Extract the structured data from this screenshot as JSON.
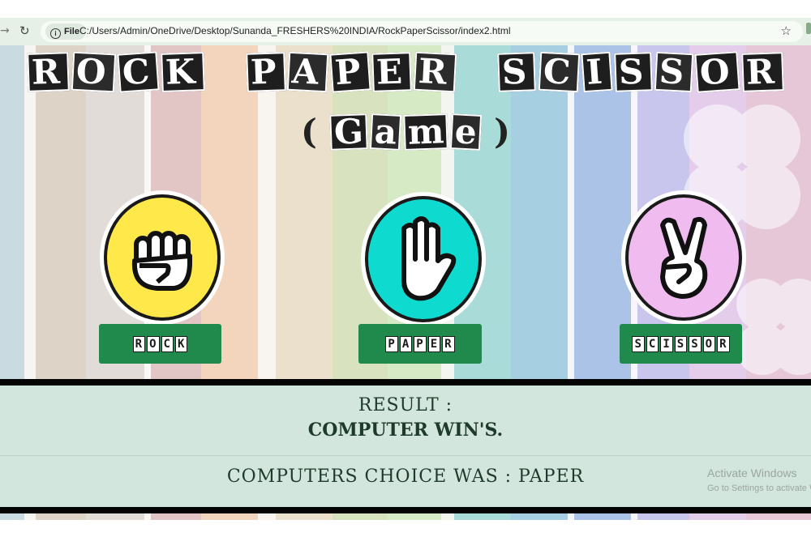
{
  "browser": {
    "file_label": "File",
    "url": "C:/Users/Admin/OneDrive/Desktop/Sunanda_FRESHERS%20INDIA/RockPaperScissor/index2.html"
  },
  "game": {
    "title_words": [
      "ROCK",
      "PAPER",
      "SCISSOR"
    ],
    "subtitle": "Game",
    "choices": [
      {
        "label": "ROCK",
        "circle_color": "#ffe94a",
        "icon": "fist-icon"
      },
      {
        "label": "PAPER",
        "circle_color": "#0fdad0",
        "icon": "open-hand-icon"
      },
      {
        "label": "SCISSOR",
        "circle_color": "#f0bcef",
        "icon": "victory-hand-icon"
      }
    ],
    "button_color": "#1f8a4c"
  },
  "result": {
    "heading": "RESULT :",
    "text": "COMPUTER WIN'S.",
    "computer_choice": "COMPUTERS CHOICE WAS : PAPER"
  },
  "watermark": {
    "line1": "Activate Windows",
    "line2": "Go to Settings to activate W"
  }
}
